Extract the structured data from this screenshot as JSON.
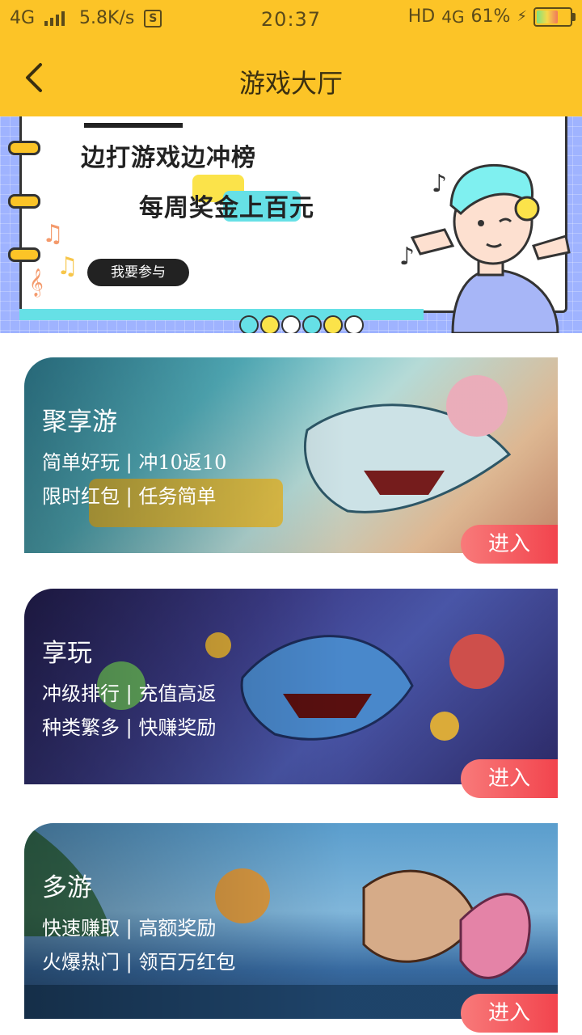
{
  "status_bar": {
    "network": "4G",
    "speed": "5.8K/s",
    "time": "20:37",
    "hd": "HD",
    "network_right": "4G",
    "battery": "61%"
  },
  "header": {
    "title": "游戏大厅"
  },
  "banner": {
    "headline": "边打游戏边冲榜",
    "subheadline": "每周奖金上百元",
    "button_label": "我要参与"
  },
  "cards": [
    {
      "title": "聚享游",
      "line1": "简单好玩 | 冲10返10",
      "line2": "限时红包 | 任务简单",
      "enter_label": "进入"
    },
    {
      "title": "享玩",
      "line1": "冲级排行 | 充值高返",
      "line2": "种类繁多 | 快赚奖励",
      "enter_label": "进入"
    },
    {
      "title": "多游",
      "line1": "快速赚取 | 高额奖励",
      "line2": "火爆热门 | 领百万红包",
      "enter_label": "进入"
    }
  ],
  "colors": {
    "header_bg": "#fcc427",
    "enter_button": "#f2444d",
    "banner_accent_cyan": "#66e0e6"
  }
}
